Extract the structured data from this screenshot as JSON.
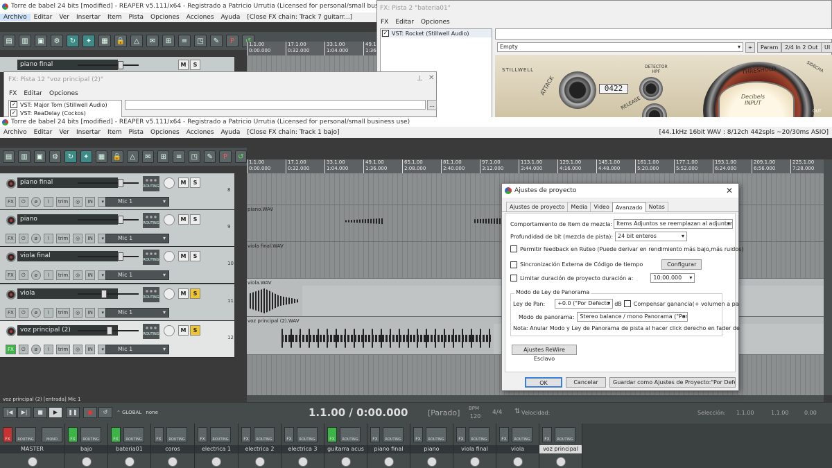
{
  "back_window": {
    "title": "Torre de babel 24 bits [modified] - REAPER v5.111/x64 - Registrado a Patricio Urrutia (Licensed for personal/small business use)",
    "menu": [
      "Archivo",
      "Editar",
      "Ver",
      "Insertar",
      "Item",
      "Pista",
      "Opciones",
      "Acciones",
      "Ayuda",
      "[Close FX chain: Track 7 guitarr...]"
    ],
    "ruler": [
      [
        "1.1.00",
        "0:00.000"
      ],
      [
        "17.1.00",
        "0:32.000"
      ],
      [
        "33.1.00",
        "1:04.000"
      ],
      [
        "49.1.00",
        "1:36.000"
      ]
    ],
    "track_name": "piano final"
  },
  "fx_bateria": {
    "title": "FX: Pista 2 \"bateria01\"",
    "menu": [
      "FX",
      "Editar",
      "Opciones"
    ],
    "plugin": "VST: Rocket (Stillwell Audio)",
    "preset": "Empty",
    "buttons": [
      "+",
      "Param",
      "2/4 In 2 Out",
      "UI"
    ],
    "plugin_labels": {
      "brand": "STILLWELL",
      "detector": "DETECTOR\nHPF",
      "threshold": "THRESHOLD",
      "attack": "ATTACK",
      "release": "RELEASE",
      "readout": "0422",
      "meter_label": "Decibels\nINPUT",
      "out": "OUT",
      "sidechain": "SIDECHA"
    }
  },
  "fx_voz": {
    "title": "FX: Pista 12 \"voz principal (2)\"",
    "menu": [
      "FX",
      "Editar",
      "Opciones"
    ],
    "plugins": [
      "VST: Major Tom (Stillwell Audio)",
      "VST: ReaDelay (Cockos)"
    ],
    "pin": "…"
  },
  "main_window": {
    "title": "Torre de babel 24 bits [modified] - REAPER v5.111/x64 - Registrado a Patricio Urrutia (Licensed for personal/small business use)",
    "menu": [
      "Archivo",
      "Editar",
      "Ver",
      "Insertar",
      "Item",
      "Pista",
      "Opciones",
      "Acciones",
      "Ayuda",
      "[Close FX chain: Track 1 bajo]"
    ],
    "status": "[44.1kHz 16bit WAV : 8/12ch 442spls ~20/30ms ASIO]",
    "ruler": [
      [
        "1.1.00",
        "0:00.000"
      ],
      [
        "17.1.00",
        "0:32.000"
      ],
      [
        "33.1.00",
        "1:04.000"
      ],
      [
        "49.1.00",
        "1:36.000"
      ],
      [
        "65.1.00",
        "2:08.000"
      ],
      [
        "81.1.00",
        "2:40.000"
      ],
      [
        "97.1.00",
        "3:12.000"
      ],
      [
        "113.1.00",
        "3:44.000"
      ],
      [
        "129.1.00",
        "4:16.000"
      ],
      [
        "145.1.00",
        "4:48.000"
      ],
      [
        "161.1.00",
        "5:20.000"
      ],
      [
        "177.1.00",
        "5:52.000"
      ],
      [
        "193.1.00",
        "6:24.000"
      ],
      [
        "209.1.00",
        "6:56.000"
      ],
      [
        "225.1.00",
        "7:28.000"
      ]
    ]
  },
  "tracks": [
    {
      "name": "piano final",
      "num": "8",
      "input": "Mic 1",
      "in": "IN",
      "trim": "trim",
      "solo_on": false,
      "selected": false,
      "fx_on": false
    },
    {
      "name": "piano",
      "num": "9",
      "input": "Mic 1",
      "in": "IN",
      "trim": "trim",
      "solo_on": false,
      "selected": false,
      "fx_on": false
    },
    {
      "name": "viola final",
      "num": "10",
      "input": "Mic 1",
      "in": "IN",
      "trim": "trim",
      "solo_on": false,
      "selected": false,
      "fx_on": false
    },
    {
      "name": "viola",
      "num": "11",
      "input": "Mic 1",
      "in": "IN",
      "trim": "trim",
      "solo_on": true,
      "selected": false,
      "fx_on": false
    },
    {
      "name": "voz principal (2)",
      "num": "12",
      "input": "Mic 1",
      "in": "IN",
      "trim": "trim",
      "solo_on": true,
      "selected": true,
      "fx_on": true
    }
  ],
  "mute_label": "M",
  "solo_label": "S",
  "fx_label": "FX",
  "routing_label": "ROUTING",
  "lanes": [
    {
      "label": ""
    },
    {
      "label": "piano.WAV"
    },
    {
      "label": "viola final.WAV"
    },
    {
      "label": "viola.WAV"
    },
    {
      "label": "voz principal (2).WAV"
    }
  ],
  "dialog": {
    "title": "Ajustes de proyecto",
    "close": "✕",
    "tabs": [
      "Ajustes de proyecto",
      "Media",
      "Video",
      "Avanzado",
      "Notas"
    ],
    "active_tab": "Avanzado",
    "item_mix_label": "Comportamiento de Item de mezcla:",
    "item_mix_value": "Items Adjuntos se reemplazan al adjuntarse",
    "bit_depth_label": "Profundidad de bit (mezcla de pista):",
    "bit_depth_value": "24 bit enteros",
    "feedback_label": "Permitir feedback en Ruteo (Puede derivar en rendimiento más bajo,más ruidos)",
    "sync_label": "Sincronización Externa de Código de tiempo",
    "configure": "Configurar",
    "limit_label": "Limitar duración de proyecto duración a:",
    "limit_value": "10:00.000",
    "pan_group": "Modo de Ley de Panorama",
    "pan_law_label": "Ley de Pan:",
    "pan_law_value": "+0.0 (\"Por Defecto",
    "db": "dB",
    "comp_label": "Compensar ganancia(+ volumen a pa",
    "pan_mode_label": "Modo de panorama:",
    "pan_mode_value": "Stereo balance / mono Panorama (\"Por",
    "note": "Nota: Anular Modo y Ley de Panorama de pista al hacer click derecho en fader de",
    "rewire": "Ajustes ReWire Esclavo",
    "ok": "OK",
    "cancel": "Cancelar",
    "save_default": "Guardar como Ajustes de Proyecto:\"Por Defecto\""
  },
  "status_line": "voz principal (2) [entrada] Mic 1",
  "transport": {
    "global": "GLOBAL",
    "none": "none",
    "position": "1.1.00 / 0:00.000",
    "state": "[Parado]",
    "bpm_label": "BPM",
    "bpm": "120",
    "sig": "4/4",
    "velocity": "Velocidad:",
    "selection_label": "Selección:",
    "sel_start": "1.1.00",
    "sel_end": "1.1.00",
    "sel_len": "0.00"
  },
  "mixer": [
    {
      "name": "MASTER",
      "fx": "r",
      "extra": "MONO"
    },
    {
      "name": "bajo",
      "fx": "g"
    },
    {
      "name": "bateria01",
      "fx": "g"
    },
    {
      "name": "coros",
      "fx": ""
    },
    {
      "name": "electrica 1",
      "fx": ""
    },
    {
      "name": "electrica 2",
      "fx": ""
    },
    {
      "name": "electrica 3",
      "fx": ""
    },
    {
      "name": "guitarra acus",
      "fx": "g"
    },
    {
      "name": "piano final",
      "fx": ""
    },
    {
      "name": "piano",
      "fx": ""
    },
    {
      "name": "viola final",
      "fx": ""
    },
    {
      "name": "viola",
      "fx": ""
    },
    {
      "name": "voz principal",
      "fx": "",
      "selected": true
    }
  ]
}
